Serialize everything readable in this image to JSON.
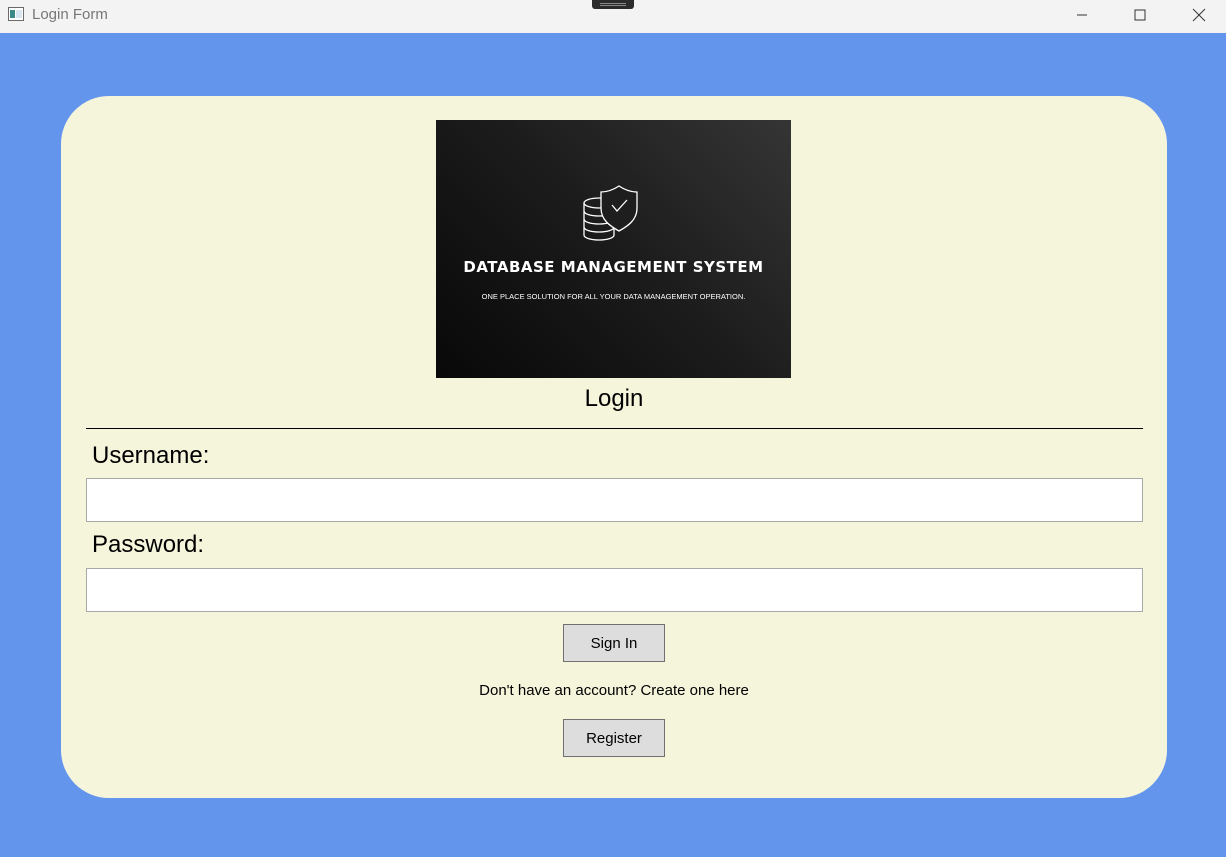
{
  "window": {
    "title": "Login Form",
    "background_color": "#6495ED",
    "controls": {
      "minimize_icon": "minimize-icon",
      "maximize_icon": "maximize-icon",
      "close_icon": "close-icon"
    }
  },
  "banner": {
    "title": "DATABASE MANAGEMENT SYSTEM",
    "subtitle": "ONE PLACE SOLUTION FOR ALL YOUR DATA MANAGEMENT OPERATION.",
    "logo_icon": "database-shield-icon"
  },
  "form": {
    "heading": "Login",
    "username_label": "Username:",
    "username_value": "",
    "password_label": "Password:",
    "password_value": "",
    "signin_label": "Sign In",
    "account_prompt": "Don't have an account? Create one here",
    "register_label": "Register",
    "card_color": "#F5F5DC"
  }
}
